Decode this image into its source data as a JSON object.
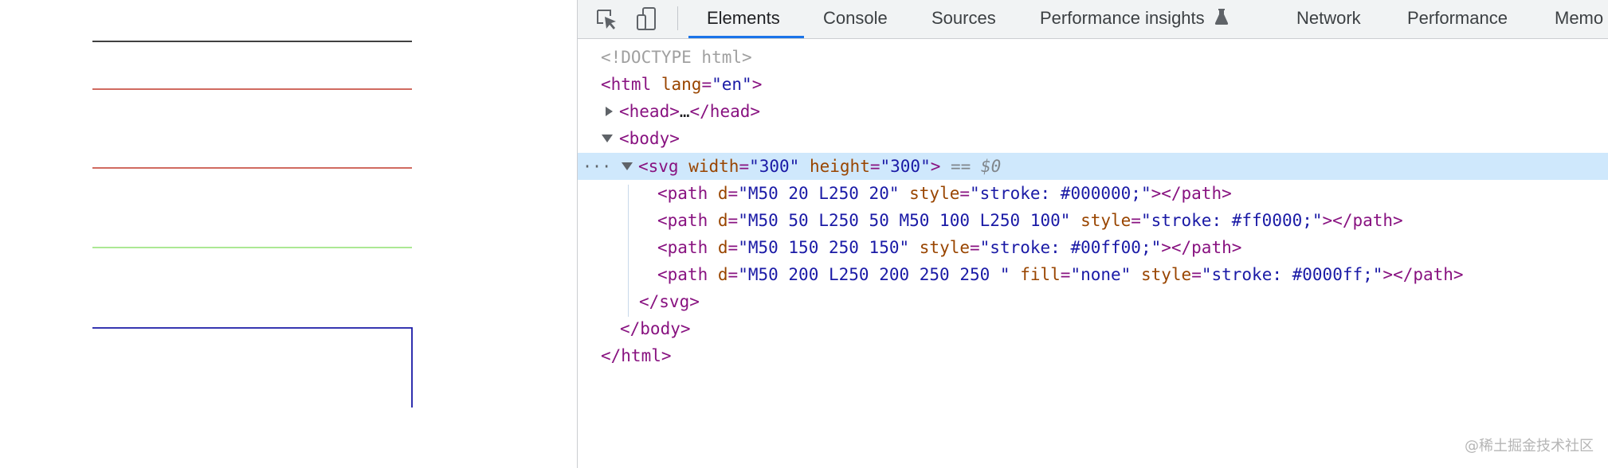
{
  "devtools": {
    "tabs": [
      {
        "label": "Elements",
        "active": true
      },
      {
        "label": "Console",
        "active": false
      },
      {
        "label": "Sources",
        "active": false
      },
      {
        "label": "Performance insights",
        "active": false,
        "icon": "flask-icon"
      },
      {
        "label": "Network",
        "active": false
      },
      {
        "label": "Performance",
        "active": false
      },
      {
        "label": "Memo",
        "active": false
      }
    ],
    "toolbar_icons": [
      "inspect-element-icon",
      "device-toolbar-icon"
    ],
    "accent_color": "#1a73e8",
    "selection_color": "#cfe8fc"
  },
  "tree": {
    "doctype": "<!DOCTYPE html>",
    "html_open": {
      "tag": "<html",
      "attr": "lang",
      "value": "\"en\"",
      "close": ">"
    },
    "head": {
      "open": "<head>",
      "ellipsis": "…",
      "close": "</head>"
    },
    "body_open": "<body>",
    "svg": {
      "tag": "<svg",
      "a1": "width",
      "v1": "\"300\"",
      "a2": "height",
      "v2": "\"300\"",
      "close": ">",
      "eq": "==",
      "ref": "$0",
      "dots": "···"
    },
    "paths": [
      {
        "open": "<path",
        "d_attr": "d",
        "d_val": "\"M50 20 L250 20\"",
        "extra_attr": "",
        "extra_val": "",
        "style_attr": "style",
        "style_val": "\"stroke: #000000;\"",
        "close": "></path>"
      },
      {
        "open": "<path",
        "d_attr": "d",
        "d_val": "\"M50 50 L250 50 M50 100 L250 100\"",
        "extra_attr": "",
        "extra_val": "",
        "style_attr": "style",
        "style_val": "\"stroke: #ff0000;\"",
        "close": "></path>"
      },
      {
        "open": "<path",
        "d_attr": "d",
        "d_val": "\"M50 150 250 150\"",
        "extra_attr": "",
        "extra_val": "",
        "style_attr": "style",
        "style_val": "\"stroke: #00ff00;\"",
        "close": "></path>"
      },
      {
        "open": "<path",
        "d_attr": "d",
        "d_val": "\"M50 200 L250 200 250 250 \"",
        "extra_attr": "fill",
        "extra_val": "\"none\"",
        "style_attr": "style",
        "style_val": "\"stroke: #0000ff;\"",
        "close": "></path>"
      }
    ],
    "svg_close": "</svg>",
    "body_close": "</body>",
    "html_close": "</html>"
  },
  "preview": {
    "line_colors": [
      "#000000",
      "#c0392b",
      "#c0392b",
      "#90e070",
      "#1a1aa6"
    ]
  },
  "watermark": "@稀土掘金技术社区"
}
